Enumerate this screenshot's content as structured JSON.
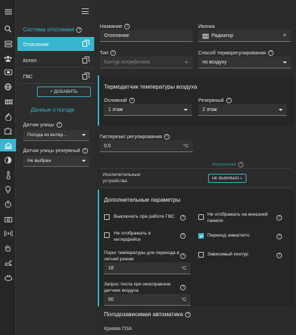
{
  "rail": {
    "icons": [
      "menu-icon",
      "search-icon",
      "storage-icon",
      "users-icon",
      "screen-icon",
      "globe-icon",
      "radiator-icon",
      "fire-icon",
      "puzzle-icon",
      "adjust-icon",
      "building-icon",
      "contrast-icon",
      "thermometer-icon",
      "lightbulb-icon",
      "stopwatch-icon",
      "camera-icon",
      "signal-icon",
      "hand-icon",
      "water-icon",
      "plate-icon"
    ]
  },
  "panel": {
    "section_title": "Система отопления",
    "circuits": [
      "Отопление",
      "Котел",
      "ГВС"
    ],
    "add_button": "+ ДОБАВИТЬ",
    "weather_title": "Данные о погоде",
    "street_sensor_label": "Датчик улицы",
    "street_sensor_value": "Погода из интер...",
    "street_sensor_backup_label": "Датчик улицы резервный",
    "street_sensor_backup_value": "Не выбран"
  },
  "main": {
    "name_label": "Название",
    "name_value": "Отопление",
    "icon_label": "Иконка",
    "icon_value": "Радиатор",
    "type_label": "Тип",
    "type_placeholder": "Контур потребителя",
    "method_label": "Способ терморегулирования",
    "method_value": "по воздуху",
    "sensor_card": {
      "title": "Термодатчик температуры воздуха",
      "main_label": "Основной",
      "main_value": "1 этаж",
      "backup_label": "Резервный",
      "backup_value": "2 этаж"
    },
    "hysteresis_label": "Гистерезис регулирования",
    "hysteresis_value": "0,5",
    "hysteresis_unit": "°C",
    "exceptions_header": "Исключения",
    "exclusive_devices_label": "Исключительные устройства",
    "not_selected_button": "НЕ ВЫБРАНО +",
    "extra_card": {
      "title": "Дополнительные параметры",
      "off_dhw_label": "Выключать при работе ГВС",
      "hide_interface_label": "Не отображать в интерфейсе",
      "hide_external_label": "Не отображать на внешней панели",
      "season_switch_label": "Переход зима/лето",
      "dependent_label": "Зависимый контур",
      "summer_threshold_label": "Порог температуры для перехода в летний режим",
      "summer_threshold_value": "18",
      "summer_threshold_unit": "°C",
      "heat_request_label": "Запрос тепла при неисправном датчике воздуха",
      "heat_request_value": "50",
      "heat_request_unit": "°C"
    },
    "weather_auto_title": "Погодозависимая автоматика",
    "curve_label": "Кривая ПЗА"
  }
}
